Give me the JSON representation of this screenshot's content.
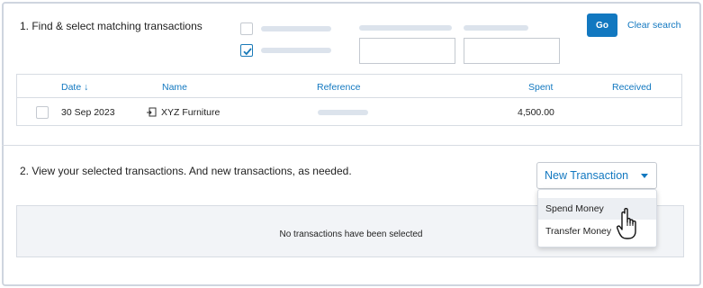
{
  "section1": {
    "title": "1. Find & select matching transactions",
    "search": {
      "go_label": "Go",
      "clear_label": "Clear search"
    }
  },
  "table": {
    "headers": {
      "date": "Date ↓",
      "name": "Name",
      "reference": "Reference",
      "spent": "Spent",
      "received": "Received"
    },
    "rows": [
      {
        "date": "30 Sep 2023",
        "name": "XYZ Furniture",
        "reference": "",
        "spent": "4,500.00",
        "received": ""
      }
    ]
  },
  "section2": {
    "title": "2. View your selected transactions. And new transactions, as needed.",
    "new_transaction_label": "New Transaction",
    "empty_message": "No transactions have been selected",
    "menu": {
      "items": [
        "Spend Money",
        "Transfer Money"
      ],
      "hovered_index": 0
    }
  },
  "colors": {
    "accent": "#1278c0",
    "border": "#d7dce3",
    "placeholder": "#dce3ec"
  },
  "icons": {
    "row_icon": "transaction-link-icon",
    "cursor": "hand-pointer-icon",
    "check": "checkmark-icon"
  }
}
